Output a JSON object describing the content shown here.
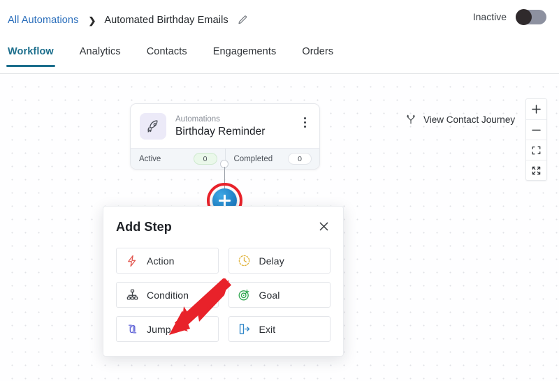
{
  "breadcrumb": {
    "root_label": "All Automations",
    "separator": "❯",
    "current_label": "Automated Birthday Emails",
    "edit_icon": "pencil-icon"
  },
  "status": {
    "label": "Inactive",
    "toggle_state": "off",
    "toggle_track_color": "#8d91a0",
    "toggle_knob_color": "#2f2a2c"
  },
  "tabs": [
    {
      "label": "Workflow",
      "active": true
    },
    {
      "label": "Analytics",
      "active": false
    },
    {
      "label": "Contacts",
      "active": false
    },
    {
      "label": "Engagements",
      "active": false
    },
    {
      "label": "Orders",
      "active": false
    }
  ],
  "tab_accent_color": "#1c6e8c",
  "canvas": {
    "dot_color": "#e0e1e6",
    "background": "#fefeff"
  },
  "automation_card": {
    "icon": "rocket-icon",
    "icon_bg": "#eceaf8",
    "subtitle": "Automations",
    "title": "Birthday Reminder",
    "menu_icon": "kebab-menu-icon",
    "stats": [
      {
        "label": "Active",
        "value": "0",
        "badge_style": "green"
      },
      {
        "label": "Completed",
        "value": "0",
        "badge_style": "white"
      }
    ]
  },
  "add_node": {
    "icon": "plus-icon",
    "color": "#1f7fc4",
    "highlight_ring_color": "#e8222a"
  },
  "annotation": {
    "arrow_color": "#e8222a",
    "points_to": "Action"
  },
  "dialog": {
    "title": "Add Step",
    "close_icon": "close-icon",
    "options": [
      {
        "label": "Action",
        "icon": "lightning-bolt-icon",
        "color": "#e2564f"
      },
      {
        "label": "Delay",
        "icon": "clock-dashed-icon",
        "color": "#e0b33c"
      },
      {
        "label": "Condition",
        "icon": "hierarchy-icon",
        "color": "#3f4348"
      },
      {
        "label": "Goal",
        "icon": "target-icon",
        "color": "#34a853"
      },
      {
        "label": "Jump",
        "icon": "jump-icon",
        "color": "#5b5fd6"
      },
      {
        "label": "Exit",
        "icon": "exit-door-icon",
        "color": "#2f86c8"
      }
    ]
  },
  "view_contact_journey": {
    "label": "View Contact Journey",
    "icon": "branch-path-icon"
  },
  "zoom_controls": [
    {
      "name": "zoom-in",
      "glyph": "+"
    },
    {
      "name": "zoom-out",
      "glyph": "−"
    },
    {
      "name": "fit-view",
      "glyph": "⛶"
    },
    {
      "name": "expand-view",
      "glyph": "⤢"
    }
  ]
}
